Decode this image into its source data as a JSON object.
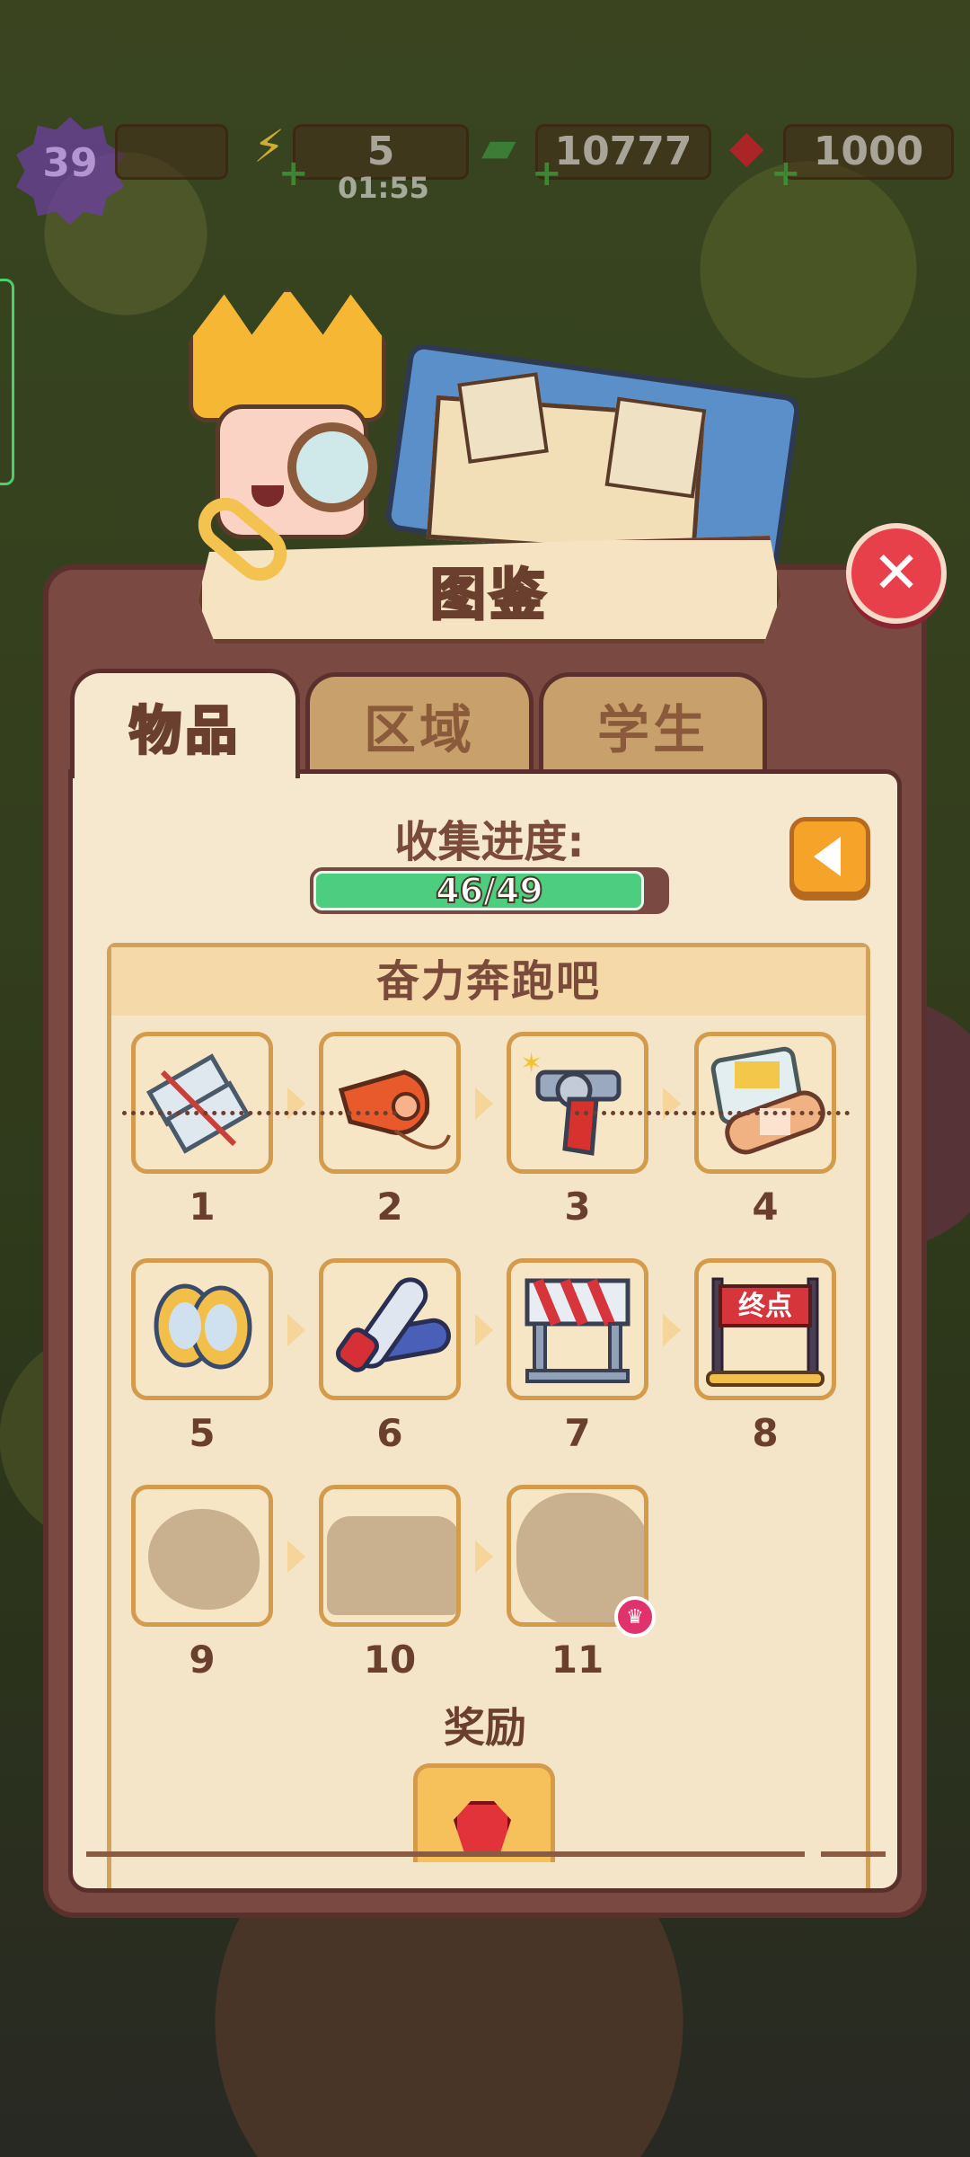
{
  "hud": {
    "level": "39",
    "energy": "5",
    "energy_timer": "01:55",
    "cash": "10777",
    "gems": "1000"
  },
  "dialog": {
    "title": "图鉴",
    "close_icon": "close-x-icon",
    "tabs": [
      {
        "label": "物品",
        "active": true
      },
      {
        "label": "区域",
        "active": false
      },
      {
        "label": "学生",
        "active": false
      }
    ],
    "progress": {
      "label": "收集进度:",
      "text": "46/49",
      "fraction": 0.939
    },
    "back_icon": "triangle-left-icon",
    "section": {
      "title": "奋力奔跑吧",
      "items": [
        {
          "num": "1",
          "icon": "race-bib-icon",
          "unlocked": true
        },
        {
          "num": "2",
          "icon": "whistle-icon",
          "unlocked": true
        },
        {
          "num": "3",
          "icon": "starting-pistol-icon",
          "unlocked": true
        },
        {
          "num": "4",
          "icon": "bandage-icon",
          "unlocked": true
        },
        {
          "num": "5",
          "icon": "sneakers-icon",
          "unlocked": true
        },
        {
          "num": "6",
          "icon": "relay-baton-icon",
          "unlocked": true
        },
        {
          "num": "7",
          "icon": "hurdle-icon",
          "unlocked": true
        },
        {
          "num": "8",
          "icon": "finish-line-icon",
          "finish_text": "终点",
          "unlocked": true
        },
        {
          "num": "9",
          "icon": "locked-silhouette-icon",
          "unlocked": false
        },
        {
          "num": "10",
          "icon": "locked-silhouette-icon",
          "unlocked": false
        },
        {
          "num": "11",
          "icon": "locked-silhouette-icon",
          "unlocked": false,
          "crown": true
        }
      ],
      "reward_label": "奖励",
      "reward_icon": "red-gem-icon"
    }
  }
}
